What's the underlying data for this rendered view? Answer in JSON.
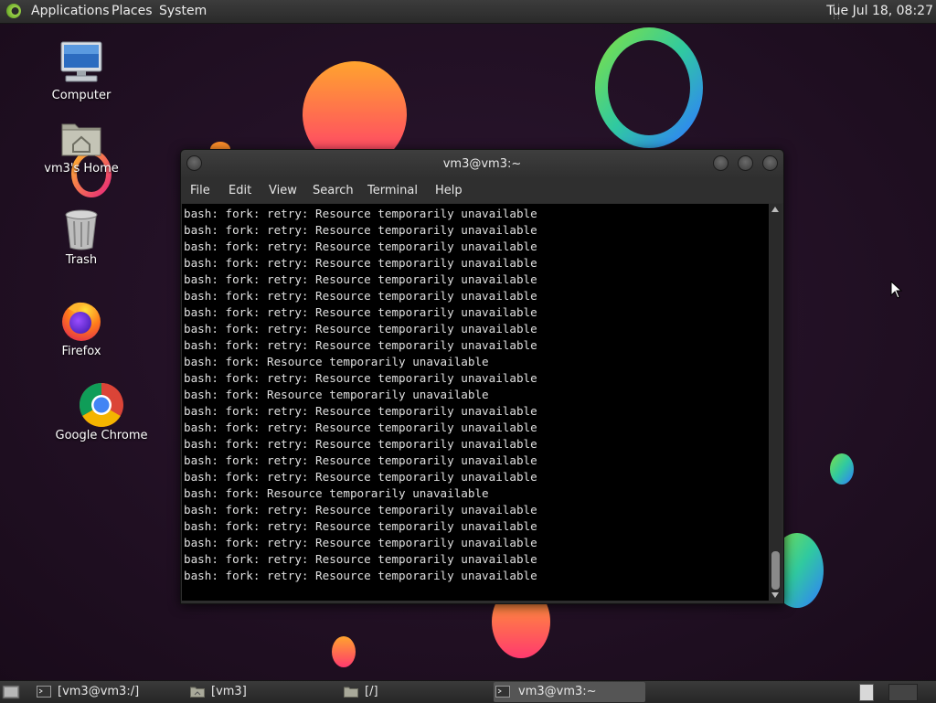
{
  "top_panel": {
    "menus": [
      "Applications",
      "Places",
      "System"
    ],
    "clock": "Tue Jul 18, 08:27"
  },
  "desktop": {
    "icons": [
      {
        "label": "Computer",
        "icon": "computer-icon"
      },
      {
        "label": "vm3's Home",
        "icon": "home-folder-icon"
      },
      {
        "label": "Trash",
        "icon": "trash-icon"
      },
      {
        "label": "Firefox",
        "icon": "firefox-icon"
      },
      {
        "label": "Google Chrome",
        "icon": "chrome-icon"
      }
    ]
  },
  "window": {
    "title": "vm3@vm3:~",
    "menubar": [
      "File",
      "Edit",
      "View",
      "Search",
      "Terminal",
      "Help"
    ],
    "terminal_lines": [
      "bash: fork: retry: Resource temporarily unavailable",
      "bash: fork: retry: Resource temporarily unavailable",
      "bash: fork: retry: Resource temporarily unavailable",
      "bash: fork: retry: Resource temporarily unavailable",
      "bash: fork: retry: Resource temporarily unavailable",
      "bash: fork: retry: Resource temporarily unavailable",
      "bash: fork: retry: Resource temporarily unavailable",
      "bash: fork: retry: Resource temporarily unavailable",
      "bash: fork: retry: Resource temporarily unavailable",
      "bash: fork: Resource temporarily unavailable",
      "bash: fork: retry: Resource temporarily unavailable",
      "bash: fork: Resource temporarily unavailable",
      "bash: fork: retry: Resource temporarily unavailable",
      "bash: fork: retry: Resource temporarily unavailable",
      "bash: fork: retry: Resource temporarily unavailable",
      "bash: fork: retry: Resource temporarily unavailable",
      "bash: fork: retry: Resource temporarily unavailable",
      "bash: fork: Resource temporarily unavailable",
      "bash: fork: retry: Resource temporarily unavailable",
      "bash: fork: retry: Resource temporarily unavailable",
      "bash: fork: retry: Resource temporarily unavailable",
      "bash: fork: retry: Resource temporarily unavailable",
      "bash: fork: retry: Resource temporarily unavailable"
    ]
  },
  "taskbar": {
    "tasks": [
      {
        "label": "[vm3@vm3:/]",
        "icon": "terminal-icon",
        "active": false
      },
      {
        "label": "[vm3]",
        "icon": "home-folder-icon",
        "active": false
      },
      {
        "label": "[/]",
        "icon": "folder-icon",
        "active": false
      },
      {
        "label": "vm3@vm3:~",
        "icon": "terminal-icon",
        "active": true
      }
    ]
  },
  "colors": {
    "desktop_bg": "#1e0f20",
    "panel_bg": "#2f2f2f",
    "terminal_bg": "#000000",
    "terminal_fg": "#e0e0e0"
  }
}
